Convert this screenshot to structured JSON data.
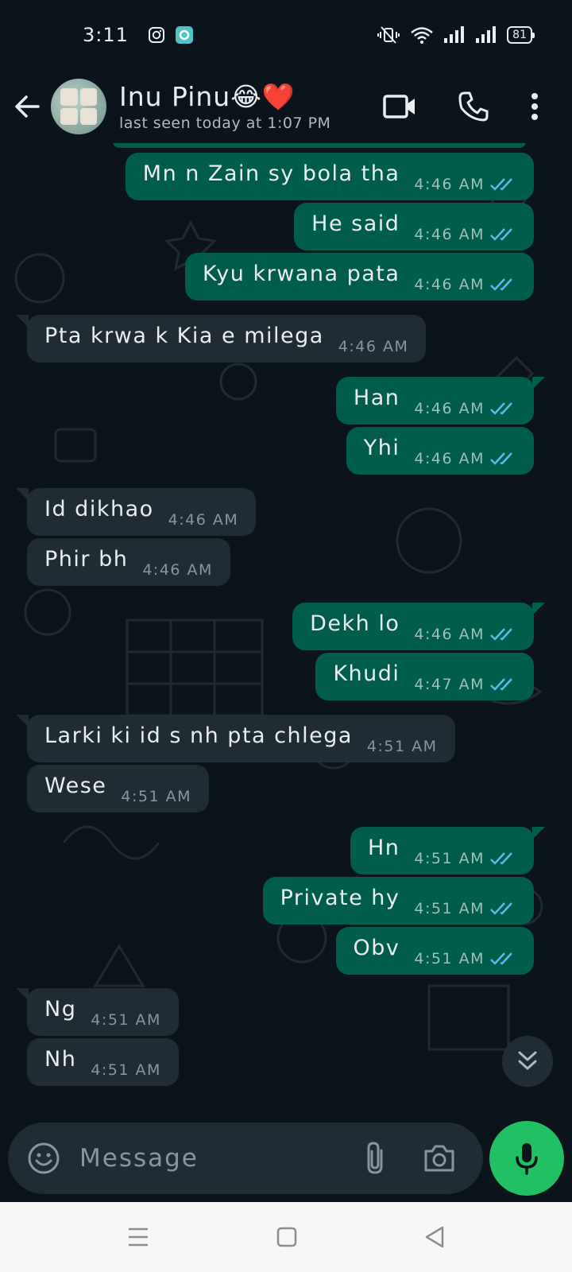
{
  "status_bar": {
    "time": "3:11",
    "battery": "81"
  },
  "header": {
    "name": "Inu Pinu😂❤️",
    "status": "last seen today at 1:07 PM"
  },
  "messages": [
    {
      "text": "Mn n Zain sy bola tha",
      "time": "4:46 AM",
      "dir": "out"
    },
    {
      "text": "He said",
      "time": "4:46 AM",
      "dir": "out"
    },
    {
      "text": "Kyu krwana pata",
      "time": "4:46 AM",
      "dir": "out"
    },
    {
      "text": "Pta krwa k Kia e milega",
      "time": "4:46 AM",
      "dir": "in"
    },
    {
      "text": "Han",
      "time": "4:46 AM",
      "dir": "out"
    },
    {
      "text": "Yhi",
      "time": "4:46 AM",
      "dir": "out"
    },
    {
      "text": "Id dikhao",
      "time": "4:46 AM",
      "dir": "in"
    },
    {
      "text": "Phir bh",
      "time": "4:46 AM",
      "dir": "in"
    },
    {
      "text": "Dekh lo",
      "time": "4:46 AM",
      "dir": "out"
    },
    {
      "text": "Khudi",
      "time": "4:47 AM",
      "dir": "out"
    },
    {
      "text": "Larki ki id s nh pta chlega",
      "time": "4:51 AM",
      "dir": "in"
    },
    {
      "text": "Wese",
      "time": "4:51 AM",
      "dir": "in"
    },
    {
      "text": "Hn",
      "time": "4:51 AM",
      "dir": "out"
    },
    {
      "text": "Private hy",
      "time": "4:51 AM",
      "dir": "out"
    },
    {
      "text": "Obv",
      "time": "4:51 AM",
      "dir": "out"
    },
    {
      "text": "Ng",
      "time": "4:51 AM",
      "dir": "in"
    },
    {
      "text": "Nh",
      "time": "4:51 AM",
      "dir": "in"
    }
  ],
  "composer": {
    "placeholder": "Message"
  },
  "colors": {
    "background": "#0b141a",
    "outgoing_bubble": "#005c4b",
    "incoming_bubble": "#202c33",
    "read_ticks": "#53bdeb",
    "mic_button": "#21c063"
  },
  "icons": {
    "back": "arrow-left-icon",
    "video": "video-call-icon",
    "call": "phone-icon",
    "menu": "more-vertical-icon",
    "emoji": "emoji-icon",
    "attach": "paperclip-icon",
    "camera": "camera-icon",
    "mic": "mic-icon",
    "scroll": "double-chevron-down-icon"
  }
}
